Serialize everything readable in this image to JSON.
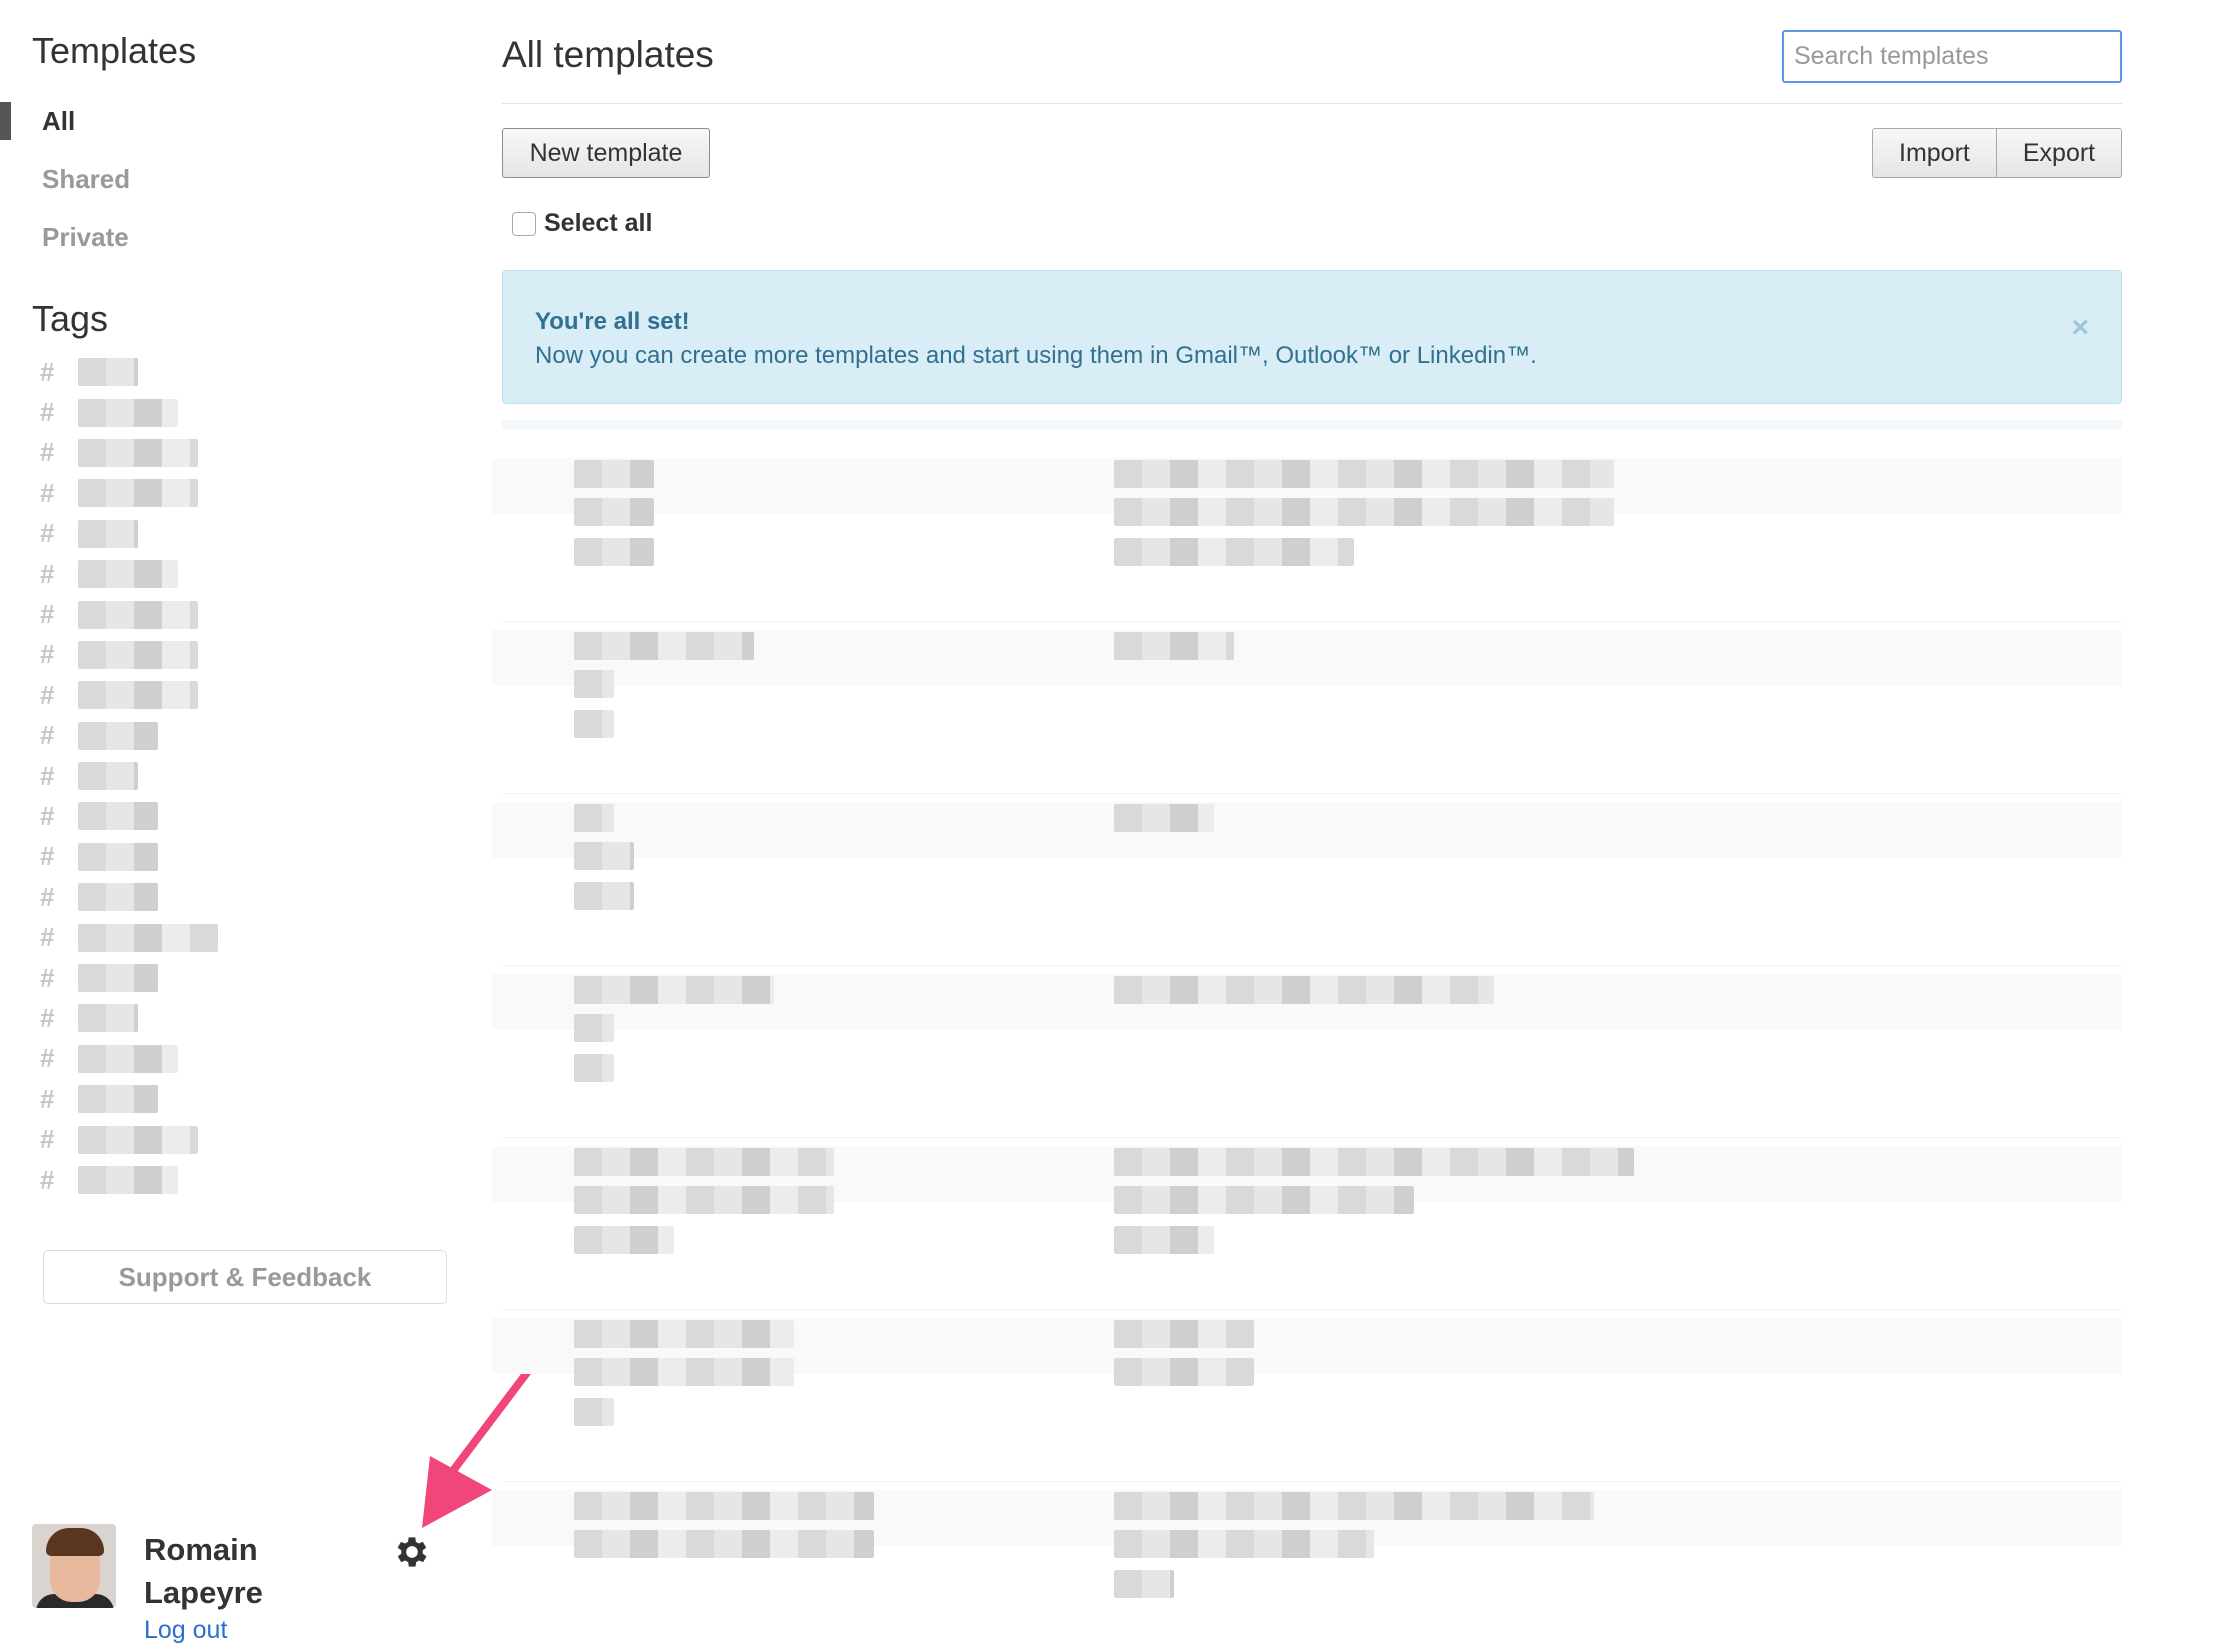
{
  "sidebar": {
    "title": "Templates",
    "nav": [
      {
        "label": "All",
        "active": true
      },
      {
        "label": "Shared",
        "active": false
      },
      {
        "label": "Private",
        "active": false
      }
    ],
    "tags_title": "Tags",
    "tag_hash": "#",
    "support_label": "Support & Feedback",
    "user": {
      "name": "Romain Lapeyre",
      "logout_label": "Log out"
    },
    "icons": {
      "settings": "gear-icon",
      "annotation": "pink-arrow-icon"
    }
  },
  "main": {
    "title": "All templates",
    "search_placeholder": "Search templates",
    "new_template_label": "New template",
    "import_label": "Import",
    "export_label": "Export",
    "select_all_label": "Select all",
    "alert": {
      "title": "You're all set!",
      "text": "Now you can create more templates and start using them in Gmail™, Outlook™ or Linkedin™.",
      "close": "×"
    }
  },
  "colors": {
    "accent_link": "#2a6fc9",
    "alert_bg": "#d9edf7",
    "alert_text": "#31708f",
    "annotation_arrow": "#f0467a",
    "search_border": "#5b95e6"
  }
}
